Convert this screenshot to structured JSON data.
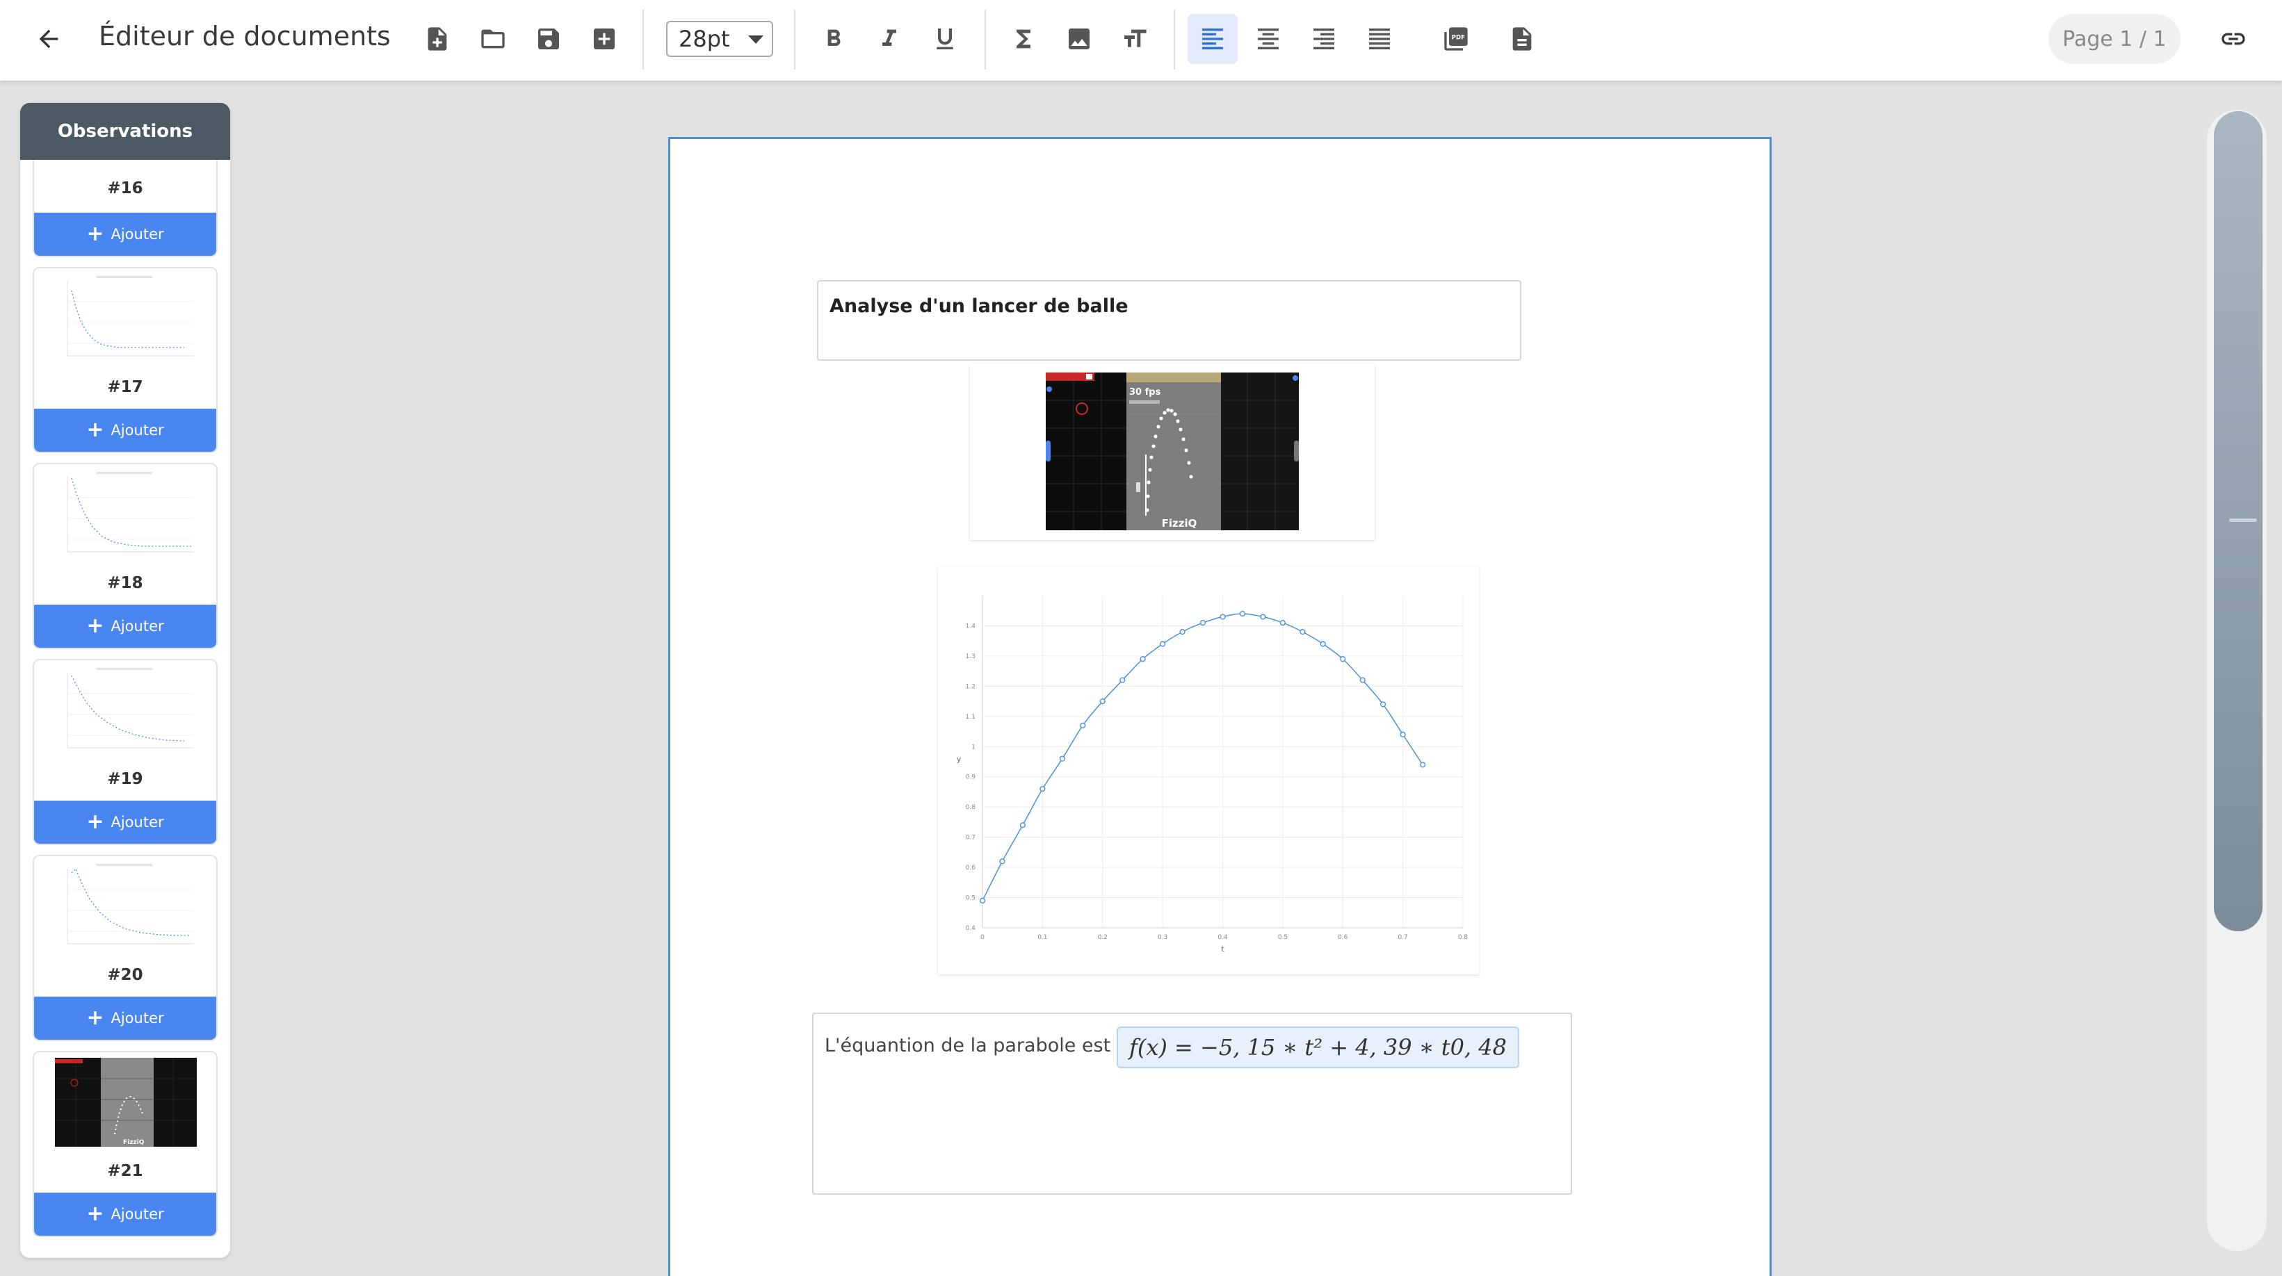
{
  "toolbar": {
    "title": "Éditeur de documents",
    "font_size": "28pt",
    "page_indicator": "Page 1 / 1"
  },
  "sidebar": {
    "header": "Observations",
    "add_label": "Ajouter",
    "items": [
      {
        "label": "#16",
        "thumb": "none"
      },
      {
        "label": "#17",
        "thumb": "decay-chart"
      },
      {
        "label": "#18",
        "thumb": "decay-chart"
      },
      {
        "label": "#19",
        "thumb": "decay-chart"
      },
      {
        "label": "#20",
        "thumb": "decay-chart"
      },
      {
        "label": "#21",
        "thumb": "video-frame"
      }
    ]
  },
  "document": {
    "title": "Analyse d'un lancer de balle",
    "video_frame": {
      "fps_label": "30 fps",
      "watermark": "FizziQ"
    },
    "equation_text": "L'équantion de la parabole est",
    "equation_math": "f(x) = −5, 15 ∗ t² + 4, 39 ∗ t0, 48"
  },
  "chart_data": {
    "type": "line",
    "xlabel": "t",
    "ylabel": "y",
    "xlim": [
      0,
      0.8
    ],
    "ylim": [
      0.4,
      1.5
    ],
    "xticks": [
      "0",
      "0.1",
      "0.2",
      "0.3",
      "0.4",
      "0.5",
      "0.6",
      "0.7",
      "0.8"
    ],
    "yticks": [
      "0.4",
      "0.5",
      "0.6",
      "0.7",
      "0.8",
      "0.9",
      "1",
      "1.1",
      "1.2",
      "1.3",
      "1.4"
    ],
    "grid": true,
    "series": [
      {
        "color": "#4a90e2",
        "x": [
          0,
          0.033,
          0.067,
          0.1,
          0.133,
          0.167,
          0.2,
          0.233,
          0.267,
          0.3,
          0.333,
          0.367,
          0.4,
          0.433,
          0.467,
          0.5,
          0.533,
          0.567,
          0.6,
          0.633,
          0.667,
          0.7,
          0.733
        ],
        "y": [
          0.49,
          0.62,
          0.74,
          0.86,
          0.96,
          1.07,
          1.15,
          1.22,
          1.29,
          1.34,
          1.38,
          1.41,
          1.43,
          1.44,
          1.43,
          1.41,
          1.38,
          1.34,
          1.29,
          1.22,
          1.14,
          1.04,
          0.94
        ]
      }
    ]
  },
  "colors": {
    "accent": "#4a86f0",
    "sidebar_header": "#4d5a63",
    "page_border": "#4a90e2",
    "series": "#4a90e2"
  }
}
